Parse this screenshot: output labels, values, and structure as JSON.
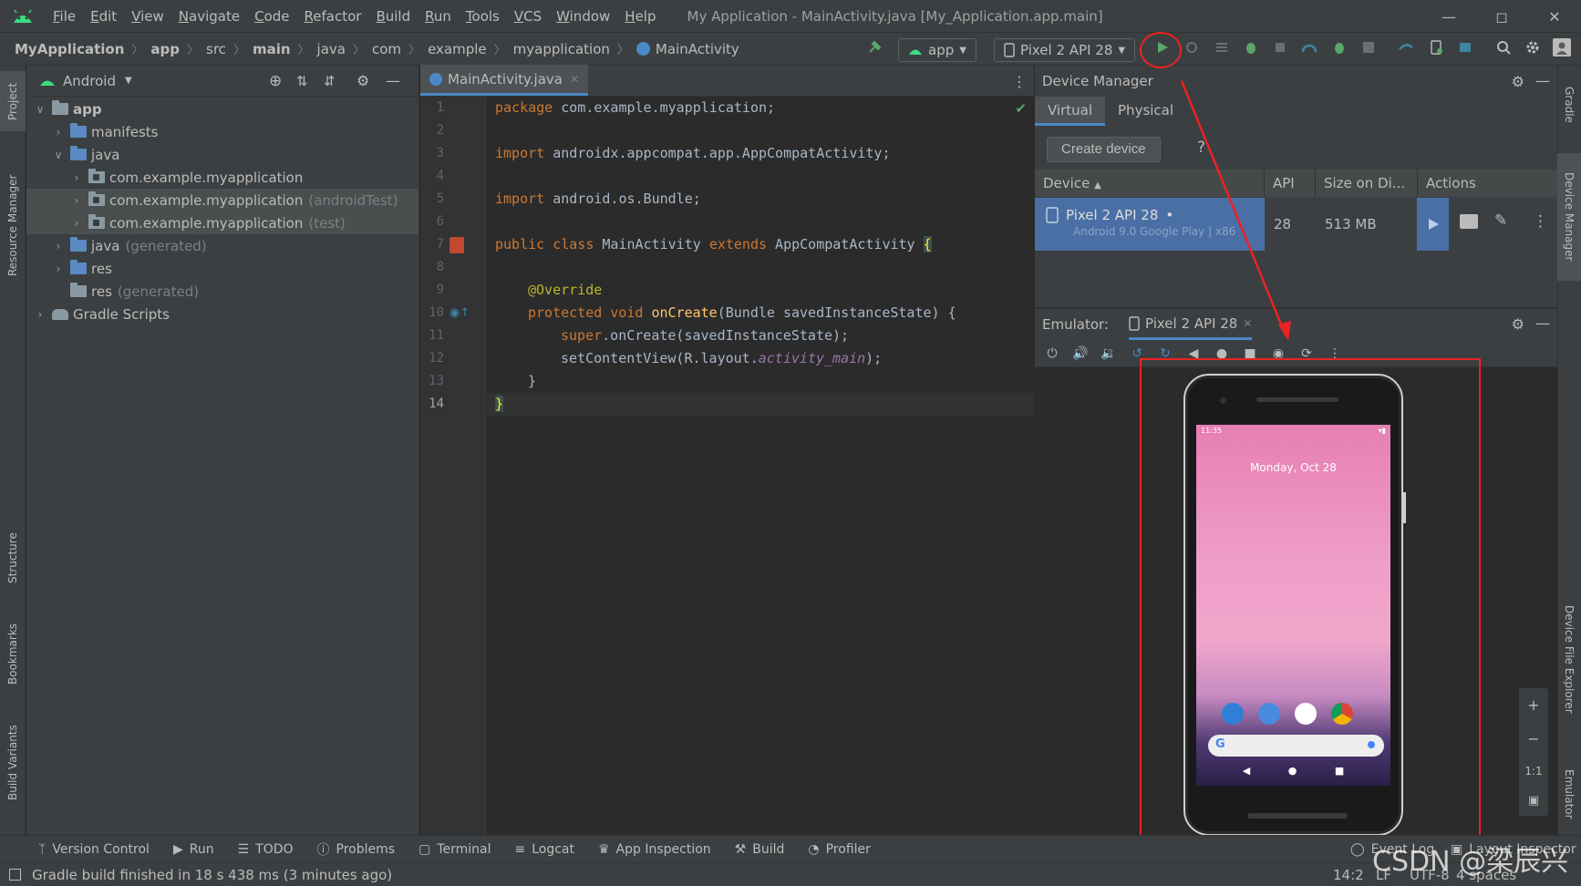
{
  "menubar": {
    "items": [
      "File",
      "Edit",
      "View",
      "Navigate",
      "Code",
      "Refactor",
      "Build",
      "Run",
      "Tools",
      "VCS",
      "Window",
      "Help"
    ],
    "window_title": "My Application - MainActivity.java [My_Application.app.main]"
  },
  "navbar": {
    "breadcrumbs": [
      "MyApplication",
      "app",
      "src",
      "main",
      "java",
      "com",
      "example",
      "myapplication",
      "MainActivity"
    ],
    "run_config": "app",
    "device": "Pixel 2 API 28"
  },
  "project": {
    "view_label": "Android",
    "tree": [
      {
        "label": "app",
        "suffix": ""
      },
      {
        "label": "manifests",
        "suffix": ""
      },
      {
        "label": "java",
        "suffix": ""
      },
      {
        "label": "com.example.myapplication",
        "suffix": ""
      },
      {
        "label": "com.example.myapplication",
        "suffix": "(androidTest)"
      },
      {
        "label": "com.example.myapplication",
        "suffix": "(test)"
      },
      {
        "label": "java",
        "suffix": "(generated)"
      },
      {
        "label": "res",
        "suffix": ""
      },
      {
        "label": "res",
        "suffix": "(generated)"
      },
      {
        "label": "Gradle Scripts",
        "suffix": ""
      }
    ]
  },
  "editor": {
    "tab_label": "MainActivity.java",
    "line_numbers": [
      "1",
      "2",
      "3",
      "4",
      "5",
      "6",
      "7",
      "8",
      "9",
      "10",
      "11",
      "12",
      "13",
      "14"
    ],
    "code": {
      "l1_kw": "package",
      "l1_rest": " com.example.myapplication;",
      "l3_kw": "import",
      "l3_rest": " androidx.appcompat.app.AppCompatActivity;",
      "l5_kw": "import",
      "l5_rest": " android.os.Bundle;",
      "l7_kw1": "public class",
      "l7_name": " MainActivity ",
      "l7_kw2": "extends",
      "l7_base": " AppCompatActivity ",
      "l7_brace": "{",
      "l9_annotation": "@Override",
      "l10_kw": "protected void",
      "l10_fn": "onCreate",
      "l10_rest": "(Bundle savedInstanceState) {",
      "l11_kw": "super",
      "l11_rest": ".onCreate(savedInstanceState);",
      "l12_pre": "setContentView(R.layout.",
      "l12_it": "activity_main",
      "l12_post": ");",
      "l13": "}",
      "l14": "}"
    }
  },
  "device_manager": {
    "title": "Device Manager",
    "tabs": [
      "Virtual",
      "Physical"
    ],
    "create_button": "Create device",
    "help": "?",
    "columns": [
      "Device",
      "API",
      "Size on Di...",
      "Actions"
    ],
    "device": {
      "name": "Pixel 2 API 28",
      "dot": "•",
      "subtitle": "Android 9.0 Google Play | x86",
      "api": "28",
      "size": "513 MB"
    }
  },
  "emulator": {
    "label": "Emulator:",
    "tab": "Pixel 2 API 28",
    "phone_time": "11:35",
    "lock_date": "Monday, Oct 28",
    "zoom_ratio": "1:1"
  },
  "right_tabs": [
    "Gradle",
    "Device Manager",
    "Device File Explorer",
    "Emulator"
  ],
  "left_tabs": [
    "Project",
    "Resource Manager",
    "Structure",
    "Bookmarks",
    "Build Variants"
  ],
  "toolwindows": [
    "Version Control",
    "Run",
    "TODO",
    "Problems",
    "Terminal",
    "Logcat",
    "App Inspection",
    "Build",
    "Profiler"
  ],
  "statusbar": {
    "message": "Gradle build finished in 18 s 438 ms (3 minutes ago)",
    "position": "14:2",
    "line_sep": "LF",
    "encoding": "UTF-8",
    "indent": "4 spaces",
    "event_log": "Event Log",
    "layout_inspector": "Layout Inspector"
  },
  "watermark": "CSDN @梁辰兴",
  "colors": {
    "accent_blue": "#4a88c7",
    "run_green": "#59a869",
    "annotation_red": "#ee2222",
    "selection_blue": "#4a6fa5"
  }
}
